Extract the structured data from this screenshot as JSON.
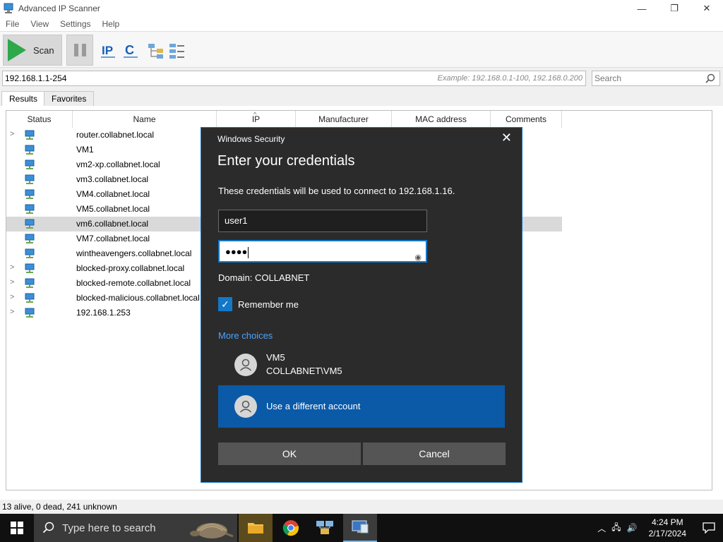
{
  "window": {
    "title": "Advanced IP Scanner",
    "minimize": "—",
    "restore": "❐",
    "close": "✕"
  },
  "menu": [
    "File",
    "View",
    "Settings",
    "Help"
  ],
  "toolbar": {
    "scan_label": "Scan"
  },
  "address": {
    "value": "192.168.1.1-254",
    "example": "Example: 192.168.0.1-100, 192.168.0.200"
  },
  "search": {
    "placeholder": "Search"
  },
  "tabs": [
    "Results",
    "Favorites"
  ],
  "columns": [
    "Status",
    "Name",
    "IP",
    "Manufacturer",
    "MAC address",
    "Comments"
  ],
  "rows": [
    {
      "name": "router.collabnet.local",
      "expandable": true
    },
    {
      "name": "VM1",
      "expandable": false
    },
    {
      "name": "vm2-xp.collabnet.local",
      "expandable": false
    },
    {
      "name": "vm3.collabnet.local",
      "expandable": false
    },
    {
      "name": "VM4.collabnet.local",
      "expandable": false
    },
    {
      "name": "VM5.collabnet.local",
      "expandable": false
    },
    {
      "name": "vm6.collabnet.local",
      "expandable": false,
      "selected": true
    },
    {
      "name": "VM7.collabnet.local",
      "expandable": false
    },
    {
      "name": "wintheavengers.collabnet.local",
      "expandable": false
    },
    {
      "name": "blocked-proxy.collabnet.local",
      "expandable": true
    },
    {
      "name": "blocked-remote.collabnet.local",
      "expandable": true
    },
    {
      "name": "blocked-malicious.collabnet.local",
      "expandable": true
    },
    {
      "name": "192.168.1.253",
      "expandable": true
    }
  ],
  "dialog": {
    "title": "Windows Security",
    "heading": "Enter your credentials",
    "message": "These credentials will be used to connect to 192.168.1.16.",
    "username": "user1",
    "password_mask": "●●●●",
    "domain": "Domain: COLLABNET",
    "remember_label": "Remember me",
    "remember_checked": true,
    "more_choices": "More choices",
    "account_name": "VM5",
    "account_full": "COLLABNET\\VM5",
    "different_account": "Use a different account",
    "ok": "OK",
    "cancel": "Cancel"
  },
  "status": "13 alive, 0 dead, 241 unknown",
  "taskbar": {
    "search_placeholder": "Type here to search",
    "time": "4:24 PM",
    "date": "2/17/2024"
  },
  "colors": {
    "accent": "#1378c8",
    "dialog_bg": "#2b2b2b",
    "selected_account": "#0a5aa8",
    "scan_green": "#2ea84a"
  }
}
